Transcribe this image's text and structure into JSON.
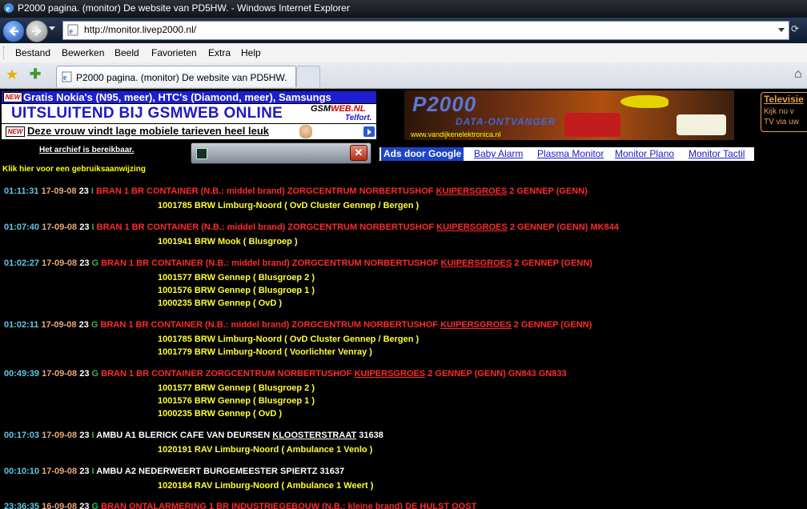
{
  "window": {
    "title": "P2000 pagina. (monitor) De website van PD5HW. - Windows Internet Explorer"
  },
  "address": {
    "url": "http://monitor.livep2000.nl/"
  },
  "menu": [
    "Bestand",
    "Bewerken",
    "Beeld",
    "Favorieten",
    "Extra",
    "Help"
  ],
  "tab": {
    "title": "P2000 pagina. (monitor) De website van PD5HW."
  },
  "ads": {
    "new_badge": "NEW",
    "line1": "Gratis Nokia's (N95, meer), HTC's (Diamond, meer), Samsungs",
    "line2": "UITSLUITEND BIJ GSMWEB ONLINE",
    "logo_a": "GSM",
    "logo_b": "WEB.NL",
    "logo_c": "Telfort.",
    "line3": "Deze vrouw vindt lage mobiele tarieven heel leuk"
  },
  "archive_link": "Het archief is bereikbaar.",
  "manual_link": "Klik hier voor een gebruiksaanwijzing",
  "banner": {
    "title": "P2000",
    "subtitle": "DATA-ONTVANGER",
    "site": "www.vandijkenelektronica.nl"
  },
  "right_ad": {
    "title": "Televisie",
    "line1": "Kijk nu v",
    "line2": "TV via uw"
  },
  "google_ads": {
    "label": "Ads door Google",
    "links": [
      "Baby Alarm",
      "Plasma Monitor",
      "Monitor Plano",
      "Monitor Tactil"
    ]
  },
  "colors": {
    "time": "#5ec8e6",
    "date": "#e8a878",
    "bran": "#ff2a2a",
    "ambu": "#ffffff",
    "units": "#ffff33"
  },
  "messages": [
    {
      "time": "01:11:31",
      "date": "17-09-08",
      "num": "23",
      "pri": "I",
      "pre": "BRAN 1 BR CONTAINER (N.B.: middel brand) ZORGCENTRUM NORBERTUSHOF ",
      "place": "KUIPERSGROES",
      "post": " 2 GENNEP (GENN)",
      "color": "#ff2a2a",
      "units": [
        "1001785 BRW Limburg-Noord ( OvD Cluster Gennep / Bergen )"
      ]
    },
    {
      "time": "01:07:40",
      "date": "17-09-08",
      "num": "23",
      "pri": "I",
      "pre": "BRAN 1 BR CONTAINER (N.B.: middel brand) ZORGCENTRUM NORBERTUSHOF ",
      "place": "KUIPERSGROES",
      "post": " 2 GENNEP (GENN) MK844",
      "color": "#ff2a2a",
      "units": [
        "1001941 BRW Mook ( Blusgroep )"
      ]
    },
    {
      "time": "01:02:27",
      "date": "17-09-08",
      "num": "23",
      "pri": "G",
      "pre": "BRAN 1 BR CONTAINER (N.B.: middel brand) ZORGCENTRUM NORBERTUSHOF ",
      "place": "KUIPERSGROES",
      "post": " 2 GENNEP (GENN)",
      "color": "#ff2a2a",
      "units": [
        "1001577 BRW Gennep ( Blusgroep 2 )",
        "1001576 BRW Gennep ( Blusgroep 1 )",
        "1000235 BRW Gennep ( OvD )"
      ]
    },
    {
      "time": "01:02:11",
      "date": "17-09-08",
      "num": "23",
      "pri": "G",
      "pre": "BRAN 1 BR CONTAINER (N.B.: middel brand) ZORGCENTRUM NORBERTUSHOF ",
      "place": "KUIPERSGROES",
      "post": " 2 GENNEP (GENN)",
      "color": "#ff2a2a",
      "units": [
        "1001785 BRW Limburg-Noord ( OvD Cluster Gennep / Bergen )",
        "1001779 BRW Limburg-Noord ( Voorlichter Venray )"
      ]
    },
    {
      "time": "00:49:39",
      "date": "17-09-08",
      "num": "23",
      "pri": "G",
      "pre": "BRAN 1 BR CONTAINER ZORGCENTRUM NORBERTUSHOF ",
      "place": "KUIPERSGROES",
      "post": " 2 GENNEP (GENN) GN843 GN833",
      "color": "#ff2a2a",
      "units": [
        "1001577 BRW Gennep ( Blusgroep 2 )",
        "1001576 BRW Gennep ( Blusgroep 1 )",
        "1000235 BRW Gennep ( OvD )"
      ]
    },
    {
      "time": "00:17:03",
      "date": "17-09-08",
      "num": "23",
      "pri": "I",
      "pre": "AMBU A1 BLERICK CAFE VAN DEURSEN ",
      "place": "KLOOSTERSTRAAT",
      "post": " 31638",
      "color": "#ffffff",
      "units": [
        "1020191 RAV Limburg-Noord ( Ambulance 1 Venlo )"
      ]
    },
    {
      "time": "00:10:10",
      "date": "17-09-08",
      "num": "23",
      "pri": "I",
      "pre": "AMBU A2 NEDERWEERT BURGEMEESTER SPIERTZ 31637",
      "place": "",
      "post": "",
      "color": "#ffffff",
      "units": [
        "1020184 RAV Limburg-Noord ( Ambulance 1 Weert )"
      ]
    },
    {
      "time": "23:36:35",
      "date": "16-09-08",
      "num": "23",
      "pri": "G",
      "pre": "BRAN ONTALARMERING 1 BR INDUSTRIEGEBOUW (N.B.: kleine brand) DE HULST OOST",
      "place": "",
      "post": "",
      "color": "#ff2a2a",
      "units": []
    }
  ]
}
